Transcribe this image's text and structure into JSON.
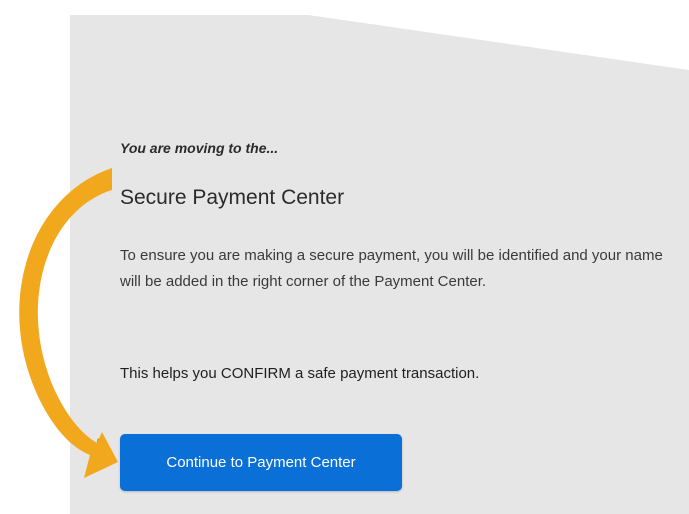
{
  "redirect_notice": {
    "eyebrow": "You are moving to the...",
    "title": "Secure Payment Center",
    "description": "To ensure you are making a secure payment, you will be identified and your name will be added in the right corner of the Payment Center.",
    "confirmation": "This helps you CONFIRM a safe payment transaction.",
    "continue_button_label": "Continue to Payment Center"
  },
  "colors": {
    "panel_background": "#e6e6e6",
    "button_background": "#0a6fd6",
    "arrow_fill": "#f2a81d",
    "arrow_shadow": "#b67c10"
  },
  "icons": {
    "pointer_arrow": "curved-arrow-icon"
  }
}
